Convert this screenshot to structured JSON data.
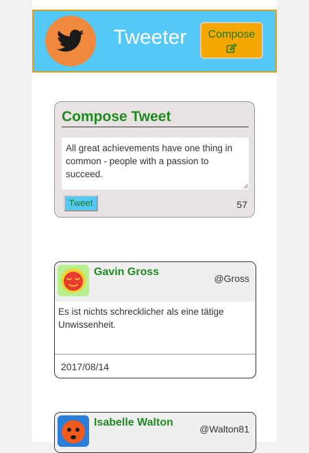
{
  "header": {
    "brand": "Tweeter",
    "compose_label": "Compose",
    "logo_icon": "twitter-bird-icon",
    "compose_icon": "edit-icon",
    "colors": {
      "header_bg": "#56c8f5",
      "logo_bg": "#f0883d",
      "compose_bg": "#f5a700",
      "accent_green": "#1f8a1f"
    }
  },
  "compose": {
    "title": "Compose Tweet",
    "text": "All great achievements have one thing in common - people with a passion to succeed.",
    "button_label": "Tweet",
    "char_count": "57"
  },
  "tweets": [
    {
      "author": "Gavin Gross",
      "handle": "@Gross",
      "text": "Es ist nichts schrecklicher als eine tätige Unwissenheit.",
      "date": "2017/08/14",
      "avatar_icon": "sleepy-face-avatar-icon"
    },
    {
      "author": "Isabelle Walton",
      "handle": "@Walton81",
      "text": "",
      "date": "",
      "avatar_icon": "sad-face-avatar-icon"
    }
  ]
}
